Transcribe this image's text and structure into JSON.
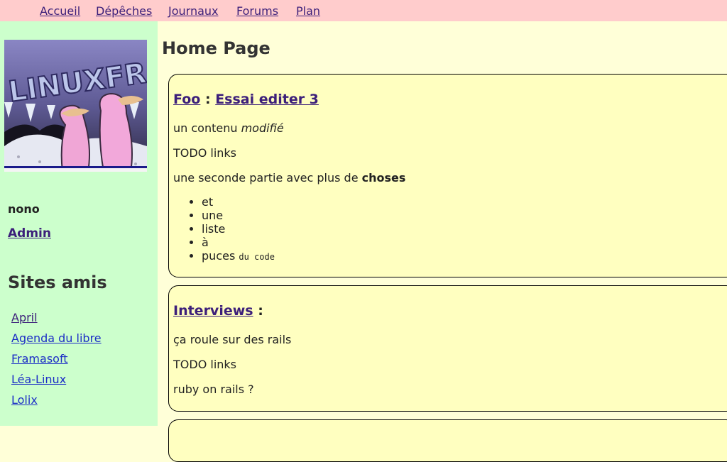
{
  "nav": {
    "items": [
      {
        "label": "Accueil"
      },
      {
        "label": "Dépêches"
      },
      {
        "label": "Journaux"
      },
      {
        "label": "Forums"
      },
      {
        "label": "Plan"
      }
    ]
  },
  "sidebar": {
    "logo_alt": "LINUXFR.ORG",
    "username": "nono",
    "admin_label": "Admin",
    "friends_title": "Sites amis",
    "friends": [
      {
        "label": "April"
      },
      {
        "label": "Agenda du libre"
      },
      {
        "label": "Framasoft"
      },
      {
        "label": "Léa-Linux"
      },
      {
        "label": "Lolix"
      }
    ]
  },
  "main": {
    "title": "Home Page",
    "articles": [
      {
        "section": "Foo",
        "separator": ":",
        "title": "Essai editer 3",
        "line1_prefix": "un contenu ",
        "line1_em": "modifié",
        "line2": "TODO links",
        "line3_prefix": "une seconde partie avec plus de ",
        "line3_strong": "choses",
        "bullets": [
          "et",
          "une",
          "liste",
          "à",
          "puces"
        ],
        "code": "du code"
      },
      {
        "section": "Interviews",
        "separator": ":",
        "line1": "ça roule sur des rails",
        "line2": "TODO links",
        "line3": "ruby on rails ?"
      }
    ]
  },
  "colors": {
    "nav_bg": "#ffcccc",
    "sidebar_bg": "#ccffcc",
    "main_bg": "#ffffd8",
    "card_bg": "#ffffc0",
    "link": "#3c1f7a"
  }
}
